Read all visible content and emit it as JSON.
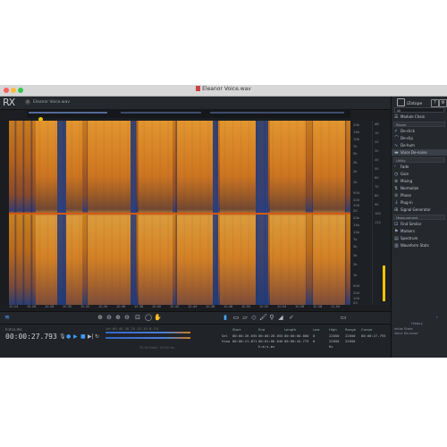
{
  "window": {
    "title": "Eleanor Voice.wav"
  },
  "app": {
    "logo": "RX"
  },
  "file_tab": {
    "name": "Eleanor Voice.wav",
    "close": "×"
  },
  "freq_labels": [
    "20k",
    "15k",
    "10k",
    "7k",
    "5k",
    "3k",
    "2k",
    "1k",
    "500",
    "200",
    "100",
    "20"
  ],
  "freq_labels_2": [
    "20k",
    "15k",
    "10k",
    "7k",
    "5k",
    "3k",
    "2k",
    "1k",
    "500",
    "200",
    "100",
    "20"
  ],
  "db_labels": [
    "dB",
    "10",
    "20",
    "30",
    "40",
    "50",
    "60",
    "70",
    "80",
    "90",
    "100",
    "110"
  ],
  "time_labels": [
    "10.24",
    "10.26",
    "10.28",
    "10.30",
    "10.32",
    "10.34",
    "10.36",
    "10.38",
    "10.40",
    "10.42",
    "10.44",
    "10.46",
    "10.48",
    "10.50",
    "10.52",
    "10.54",
    "10.56",
    "10.58",
    "11.00"
  ],
  "toolbar": {
    "zoom": "⊕",
    "icons": [
      "⊕",
      "⊖",
      "⊕",
      "⊖",
      "⊡",
      "◯",
      "▭",
      "▱",
      "◇",
      "⚲",
      "◢",
      "✓"
    ]
  },
  "transport": {
    "label": "h:m:s.ms",
    "timecode": "00:00:27.793",
    "level_scale": "-Inf  -60  -40  -30  -20  -15  -10  -6  -3  0",
    "sample_rate": "32 bit float | 44100 Hz",
    "buttons": [
      "●",
      "▶",
      "■",
      "▶|",
      "↻"
    ]
  },
  "selection": {
    "headers": [
      "Start",
      "End",
      "Length",
      "Low",
      "High",
      "Range",
      "Cursor"
    ],
    "sel_label": "Sel",
    "view_label": "View",
    "sel": [
      "00:00:26.655",
      "00:00:26.655",
      "00:00:00.000",
      "0",
      "22050",
      "22050",
      "00:00:27.793"
    ],
    "view": [
      "00:00:21.871",
      "00:01:06.646",
      "00:00:44.775",
      "0",
      "22050",
      "22050",
      "-"
    ],
    "units": "h:m:s.ms",
    "hz": "Hz"
  },
  "sidebar": {
    "brand": "iZotope",
    "preset": "All",
    "top_item": "Module Chain",
    "sections": {
      "repair": "Repair",
      "utility": "Utility",
      "measurement": "Measurement"
    },
    "repair_items": [
      "De-click",
      "De-clip",
      "De-hum",
      "Voice De-noise"
    ],
    "utility_items": [
      "Fade",
      "Gain",
      "Mixing",
      "Normalize",
      "Phase",
      "Plug-in",
      "Signal Generator"
    ],
    "measurement_items": [
      "Find Similar",
      "Markers",
      "Spectrum",
      "Waveform Stats"
    ],
    "history": {
      "header": "History",
      "initial": "Initial State",
      "last": "Voice De-noise"
    }
  }
}
